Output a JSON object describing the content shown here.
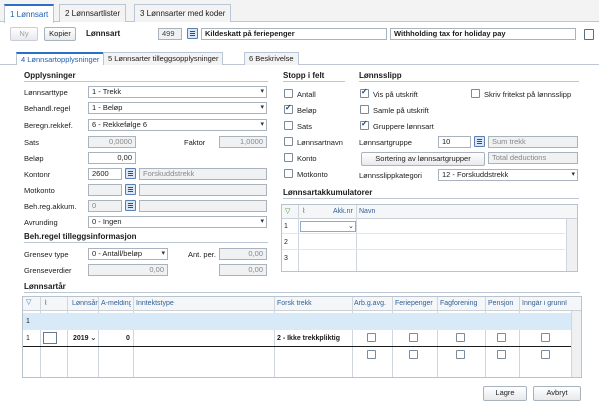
{
  "top_tabs": [
    "1 Lønnsart",
    "2 Lønnsartlister",
    "3 Lønnsarter med koder"
  ],
  "toolbar": {
    "new": "Ny",
    "copy": "Kopier",
    "lonnsart_label": "Lønnsart",
    "lonnsart_number": "499",
    "lonnsart_name": "Kildeskatt på feriepenger",
    "english_name": "Withholding tax for holiday pay"
  },
  "sub_tabs": [
    "4 Lønnsartopplysninger",
    "5 Lønnsarter tilleggsopplysninger",
    "6 Beskrivelse"
  ],
  "opplysninger": {
    "header": "Opplysninger",
    "lonnsarttype_label": "Lønnsarttype",
    "lonnsarttype": "1 - Trekk",
    "behandl_label": "Behandl.regel",
    "behandl": "1 - Beløp",
    "beregn_label": "Beregn.rekkef.",
    "beregn": "6 - Rekkefølge 6",
    "sats_label": "Sats",
    "sats": "0,0000",
    "faktor_label": "Faktor",
    "faktor": "1,0000",
    "belop_label": "Beløp",
    "belop": "0,00",
    "kontonr_label": "Kontonr",
    "kontonr": "2600",
    "kontonr_name": "Forskuddstrekk",
    "motkonto_label": "Motkonto",
    "behreg_label": "Beh.reg.akkum.",
    "behreg": "0",
    "avrunding_label": "Avrunding",
    "avrunding": "0 - Ingen"
  },
  "stopp": {
    "header": "Stopp i felt",
    "items": [
      {
        "label": "Antall",
        "checked": false
      },
      {
        "label": "Beløp",
        "checked": true
      },
      {
        "label": "Sats",
        "checked": false
      },
      {
        "label": "Lønnsartnavn",
        "checked": false
      },
      {
        "label": "Konto",
        "checked": false
      },
      {
        "label": "Motkonto",
        "checked": false
      }
    ]
  },
  "lonnsslipp": {
    "header": "Lønnsslipp",
    "vis": "Vis på utskrift",
    "skriv": "Skriv fritekst på lønnsslipp",
    "samle": "Samle på utskrift",
    "grupper": "Gruppere lønnsart",
    "gruppe_label": "Lønnsartgruppe",
    "gruppe": "10",
    "sum_trekk": "Sum trekk",
    "sortering_button": "Sortering av lønnsartgrupper",
    "total_deductions": "Total deductions",
    "kategori_label": "Lønnsslippkategori",
    "kategori": "12 - Forskuddstrekk"
  },
  "grense": {
    "header": "Beh.regel tilleggsinformasjon",
    "type_label": "Grensev type",
    "type": "0 - Antall/beløp",
    "ant_per_label": "Ant. per.",
    "ant_per": "0,00",
    "verdier_label": "Grenseverdier",
    "verdier_a": "0,00",
    "verdier_b": "0,00"
  },
  "akkumulatorer": {
    "header": "Lønnsartakkumulatorer",
    "col_akk": "Akk.nr",
    "col_navn": "Navn",
    "rows": [
      "1",
      "2",
      "3"
    ]
  },
  "lonnsartar": {
    "header": "Lønnsartår",
    "columns": [
      "Lønnsår",
      "A-melding",
      "Inntektstype",
      "Forsk trekk",
      "Arb.g.avg.",
      "Feriepenger",
      "Fagforening",
      "Pensjon",
      "Inngår i grunnl"
    ],
    "row_new": "1",
    "row1": {
      "num": "1",
      "year": "2019",
      "amelding": "0",
      "forsk_trekk": "2 - Ikke trekkpliktig"
    }
  },
  "footer": {
    "save": "Lagre",
    "cancel": "Avbryt"
  }
}
